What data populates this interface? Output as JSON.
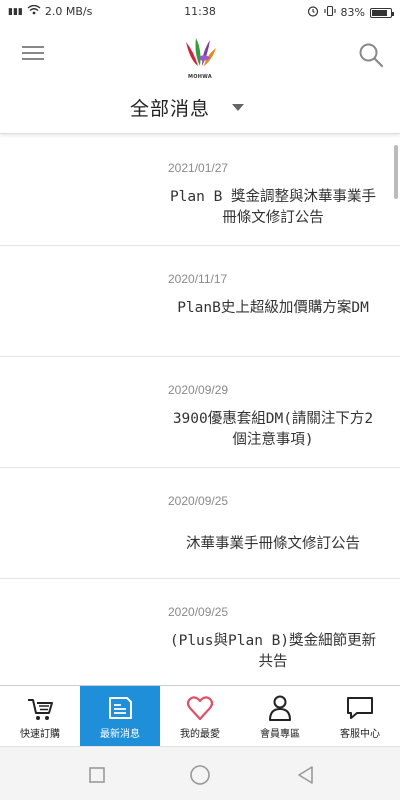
{
  "status_bar": {
    "network": "4G",
    "speed": "2.0 MB/s",
    "time": "11:38",
    "battery_text": "83%",
    "battery_level": 0.83
  },
  "header": {
    "logo_text": "MOHWA",
    "menu_icon": "hamburger-icon",
    "search_icon": "search-icon"
  },
  "category": {
    "selected": "全部消息"
  },
  "news": [
    {
      "date": "2021/01/27",
      "title": "Plan B 獎金調整與沐華事業手冊條文修訂公告"
    },
    {
      "date": "2020/11/17",
      "title": "PlanB史上超級加價購方案DM"
    },
    {
      "date": "2020/09/29",
      "title": "3900優惠套組DM(請關注下方2個注意事項)"
    },
    {
      "date": "2020/09/25",
      "title": "沐華事業手冊條文修訂公告"
    },
    {
      "date": "2020/09/25",
      "title": "(Plus與Plan B)獎金細節更新共告"
    }
  ],
  "bottom_nav": [
    {
      "label": "快速訂購",
      "icon": "cart-icon"
    },
    {
      "label": "最新消息",
      "icon": "news-icon",
      "active": true
    },
    {
      "label": "我的最愛",
      "icon": "heart-icon"
    },
    {
      "label": "會員專區",
      "icon": "person-icon"
    },
    {
      "label": "客服中心",
      "icon": "chat-icon"
    }
  ],
  "colors": {
    "accent": "#1e8fd8",
    "heart": "#e0506a"
  }
}
